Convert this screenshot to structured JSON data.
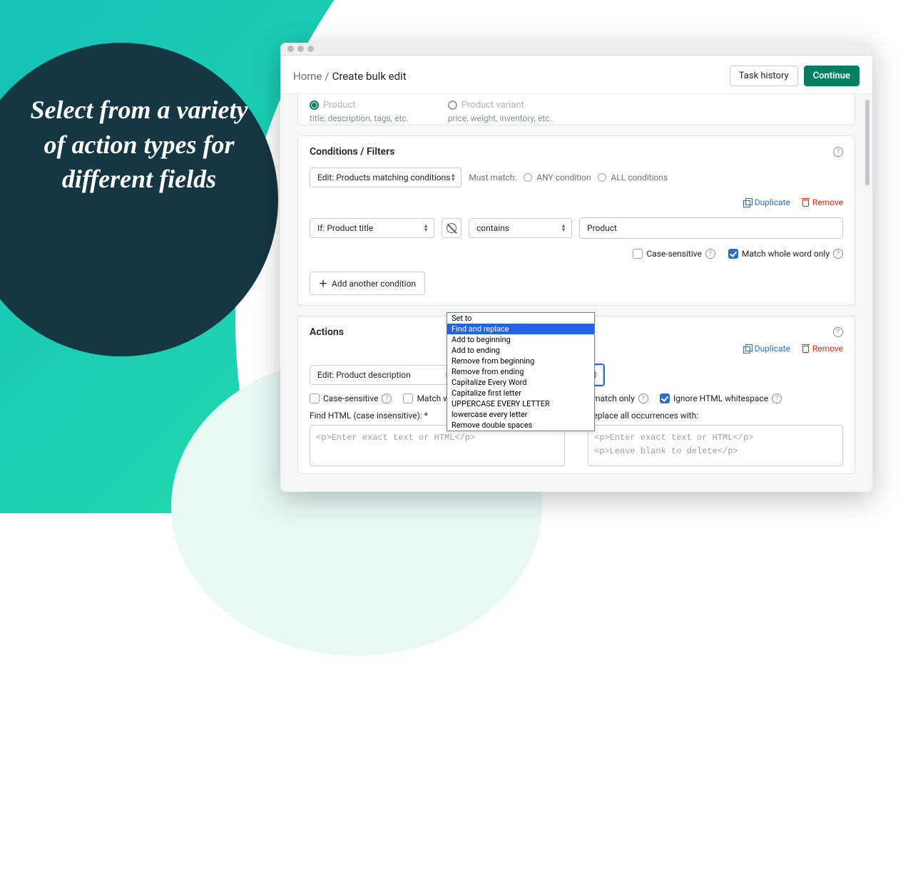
{
  "promo": "Select from a variety of action types for different fields",
  "breadcrumb": {
    "home": "Home",
    "current": "Create bulk edit"
  },
  "topButtons": {
    "history": "Task history",
    "continue": "Continue"
  },
  "entityRadios": {
    "product": {
      "label": "Product",
      "sub": "title, description, tags, etc."
    },
    "variant": {
      "label": "Product variant",
      "sub": "price, weight, inventory, etc."
    }
  },
  "conditions": {
    "title": "Conditions / Filters",
    "editSelect": "Edit: Products matching conditions",
    "mustMatch": "Must match:",
    "any": "ANY condition",
    "all": "ALL conditions",
    "duplicate": "Duplicate",
    "remove": "Remove",
    "fieldSelect": "If: Product title",
    "operatorSelect": "contains",
    "valueInput": "Product",
    "caseSensitive": "Case-sensitive",
    "matchWhole": "Match whole word only",
    "addAnother": "Add another condition"
  },
  "actions": {
    "title": "Actions",
    "duplicate": "Duplicate",
    "remove": "Remove",
    "editField": "Edit: Product description",
    "actionSelect": "Find and replace",
    "options": [
      "Set to",
      "Find and replace",
      "Add to beginning",
      "Add to ending",
      "Remove from beginning",
      "Remove from ending",
      "Capitalize Every Word",
      "Capitalize first letter",
      "UPPERCASE EVERY LETTER",
      "lowercase every letter",
      "Remove double spaces"
    ],
    "caseSensitive": "Case-sensitive",
    "matchWhole": "Match whole word only",
    "replaceFirst": "Replace first match only",
    "ignoreHtml": "Ignore HTML whitespace",
    "findLabel": "Find HTML (case insensitive): *",
    "replaceLabel": "Replace all occurrences with:",
    "findPh": "<p>Enter exact text or HTML</p>",
    "replacePh1": "<p>Enter exact text or HTML</p>",
    "replacePh2": "<p>Leave blank to delete</p>"
  }
}
